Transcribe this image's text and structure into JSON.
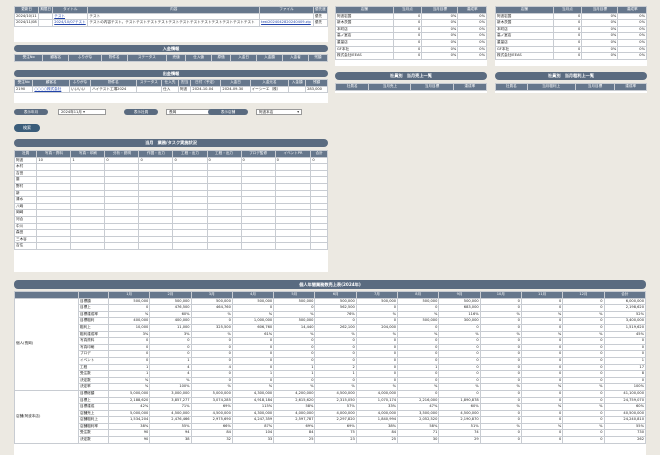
{
  "updates": {
    "headers": [
      "更新日",
      "期限日",
      "タイトル",
      "内容",
      "ファイル",
      "優先度"
    ],
    "rows": [
      [
        "2024/10/11",
        "",
        "テスト",
        "テスト",
        "",
        "優先"
      ],
      [
        "2024/11/08",
        "",
        "2024/10/07テスト",
        "テストの内容テスト。テストテストテストテストテストテストテストテストテストテストテストテスト",
        "test2024042820240409.zip",
        "優先"
      ]
    ]
  },
  "nyukin": {
    "title": "入金情報",
    "headers": [
      "受注No",
      "顧客名",
      "ふりがな",
      "物件名",
      "ステータス",
      "売値",
      "仕入値",
      "原価",
      "入金日",
      "入金額",
      "入金者",
      "残額"
    ]
  },
  "shukkin": {
    "title": "出金情報",
    "headers": [
      "受注No",
      "顧客名",
      "ふりがな",
      "物件名",
      "ステータス",
      "仕入先",
      "担当",
      "日付（予定）",
      "入金日",
      "入金元名",
      "入金額",
      "残額"
    ],
    "row": [
      "2190",
      "○○○○株式会社",
      "いいいい",
      "ハイテスト工場2024",
      "",
      "仕入",
      "阿波",
      "2024-10-04",
      "2024-09-30",
      "イーシーエ（株）",
      "",
      "283,000"
    ]
  },
  "filters": {
    "date_label": "表示年月",
    "date_value": "2024年11月",
    "staff_label": "表示社員",
    "staff_value": "長岡",
    "branch_label": "表示店舗",
    "branch_value": "阿波本店",
    "apply": "検索"
  },
  "status": {
    "title": "当月　業務/タスク実施状況",
    "headers": [
      "社員",
      "写真・資料",
      "写真・印刷",
      "分析・説明",
      "作図・出力",
      "工程・出力",
      "工程・出力",
      "プロデ監修",
      "イベントPR",
      "合計"
    ],
    "names": [
      "阿波",
      "木村",
      "吉田",
      "藤",
      "野村",
      "新",
      "清水",
      "八嶋",
      "岡崎",
      "河合",
      "中川",
      "森田",
      "三木谷",
      "吉住"
    ],
    "first": [
      "10",
      "1",
      "0",
      "0",
      "0",
      "0",
      "0",
      "0",
      "0"
    ]
  },
  "right_tables": [
    {
      "headers": [
        "店舗",
        "当月点",
        "当月目標",
        "達成率"
      ],
      "rows": [
        [
          "阿波岩国",
          "0",
          "0%",
          "0%"
        ],
        [
          "新木茨国",
          "0",
          "0%",
          "0%"
        ],
        [
          "本町店",
          "0",
          "0%",
          "0%"
        ],
        [
          "高ノ室店",
          "0",
          "0%",
          "0%"
        ],
        [
          "重量店",
          "0",
          "0%",
          "0%"
        ],
        [
          "GF本社",
          "0",
          "0%",
          "0%"
        ],
        [
          "株式会社IEEAS",
          "0",
          "0%",
          "0%"
        ]
      ]
    },
    {
      "headers": [
        "店舗",
        "当月点",
        "当月目標",
        "達成率"
      ],
      "rows": [
        [
          "阿波岩国",
          "0",
          "0%",
          "0%"
        ],
        [
          "新木茨国",
          "0",
          "0%",
          "0%"
        ],
        [
          "本町店",
          "0",
          "0%",
          "0%"
        ],
        [
          "高ノ室店",
          "0",
          "0%",
          "0%"
        ],
        [
          "重量店",
          "0",
          "0%",
          "0%"
        ],
        [
          "GF本社",
          "0",
          "0%",
          "0%"
        ],
        [
          "株式会社IEEAS",
          "0",
          "0%",
          "0%"
        ]
      ]
    }
  ],
  "month_sales": {
    "title1": "社員別　当月売上一覧",
    "title2": "社員別　当月粗利上一覧",
    "headers1": [
      "社員名",
      "当月売上",
      "当月目標",
      "達成率"
    ],
    "headers2": [
      "社員名",
      "当月粗利上",
      "当月目標",
      "達成率"
    ]
  },
  "yearly": {
    "title": "個人年間業務数売上表(2024年)",
    "months": [
      "1月",
      "2月",
      "3月",
      "4月",
      "5月",
      "6月",
      "7月",
      "8月",
      "9月",
      "10月",
      "11月",
      "12月",
      "合計"
    ],
    "groupA": "個人(長岡)",
    "groupB": "店舗(阿波本店)",
    "rowsA": [
      [
        "目標額",
        "500,000",
        "500,000",
        "500,000",
        "500,000",
        "500,000",
        "500,000",
        "500,000",
        "500,000",
        "500,000",
        "0",
        "0",
        "0",
        "6,000,000"
      ],
      [
        "目標上",
        "0",
        "476,500",
        "464,760",
        "0",
        "0",
        "562,500",
        "0",
        "0",
        "683,000",
        "0",
        "0",
        "0",
        "2,198,620"
      ],
      [
        "目標達成率",
        "%",
        "60%",
        "%",
        "%",
        "%",
        "76%",
        "%",
        "%",
        "116%",
        "%",
        "%",
        "%",
        "52%"
      ],
      [
        "目標粗利",
        "400,000",
        "400,000",
        "0",
        "1,000,000",
        "500,000",
        "0",
        "0",
        "500,000",
        "300,000",
        "0",
        "0",
        "0",
        "3,400,000"
      ],
      [
        "粗利上",
        "10,000",
        "11,000",
        "325,500",
        "606,760",
        "14,440",
        "262,100",
        "204,000",
        "0",
        "0",
        "0",
        "0",
        "0",
        "1,519,620"
      ],
      [
        "粗利達成率",
        "3%",
        "3%",
        "%",
        "61%",
        "%",
        "%",
        "%",
        "%",
        "%",
        "%",
        "%",
        "%",
        "45%"
      ],
      [
        "写真資料",
        "0",
        "0",
        "0",
        "0",
        "0",
        "0",
        "0",
        "0",
        "0",
        "0",
        "0",
        "0",
        "0"
      ],
      [
        "写真印刷",
        "0",
        "0",
        "0",
        "0",
        "0",
        "0",
        "0",
        "0",
        "0",
        "0",
        "0",
        "0",
        "0"
      ],
      [
        "プロデ",
        "0",
        "0",
        "0",
        "0",
        "0",
        "0",
        "0",
        "0",
        "0",
        "0",
        "0",
        "0",
        "0"
      ],
      [
        "イベント",
        "0",
        "1",
        "0",
        "0",
        "0",
        "0",
        "0",
        "0",
        "0",
        "0",
        "0",
        "0",
        "1"
      ],
      [
        "工程",
        "1",
        "4",
        "4",
        "0",
        "1",
        "2",
        "0",
        "1",
        "0",
        "0",
        "0",
        "0",
        "17"
      ],
      [
        "受注数",
        "1",
        "4",
        "0",
        "1",
        "1",
        "1",
        "0",
        "0",
        "0",
        "0",
        "0",
        "0",
        "8"
      ],
      [
        "決定数",
        "%",
        "%",
        "0",
        "0",
        "0",
        "0",
        "0",
        "0",
        "0",
        "0",
        "0",
        "0",
        "0"
      ],
      [
        "決定率",
        "%",
        "100%",
        "%",
        "%",
        "%",
        "%",
        "%",
        "%",
        "%",
        "%",
        "%",
        "%",
        "100%"
      ]
    ],
    "rowsB": [
      [
        "目標総額",
        "5,000,000",
        "3,000,000",
        "5,000,000",
        "4,300,000",
        "4,200,000",
        "4,500,000",
        "4,000,000",
        "0",
        "0",
        "0",
        "0",
        "0",
        "41,100,000"
      ],
      [
        "目標上",
        "2,188,620",
        "3,857,277",
        "3,074,285",
        "4,918,184",
        "2,615,620",
        "2,315,050",
        "1,070,174",
        "2,216,000",
        "1,890,878",
        "0",
        "0",
        "0",
        "24,759,070"
      ],
      [
        "目標達成",
        "42%",
        "71%",
        "69%",
        "115%",
        "58%",
        "57%",
        "33%",
        "47%",
        "60%",
        "%",
        "%",
        "%",
        "60%"
      ],
      [
        "店舗売上",
        "5,000,000",
        "4,500,000",
        "4,500,000",
        "4,300,000",
        "4,000,000",
        "4,000,000",
        "4,000,000",
        "3,500,000",
        "4,500,000",
        "0",
        "0",
        "0",
        "40,500,000"
      ],
      [
        "店舗粗利上",
        "1,534,204",
        "2,476,466",
        "2,975,690",
        "4,247,359",
        "2,597,787",
        "2,297,820",
        "1,840,994",
        "2,052,520",
        "2,190,870",
        "0",
        "0",
        "0",
        "24,240,810"
      ],
      [
        "店舗粗利率",
        "38%",
        "55%",
        "66%",
        "87%",
        "69%",
        "69%",
        "38%",
        "58%",
        "51%",
        "%",
        "%",
        "%",
        "55%"
      ],
      [
        "受注数",
        "90",
        "94",
        "84",
        "104",
        "84",
        "75",
        "84",
        "71",
        "74",
        "0",
        "0",
        "0",
        "730"
      ],
      [
        "決定数",
        "90",
        "38",
        "32",
        "33",
        "25",
        "23",
        "25",
        "30",
        "29",
        "0",
        "0",
        "0",
        "262"
      ]
    ]
  }
}
